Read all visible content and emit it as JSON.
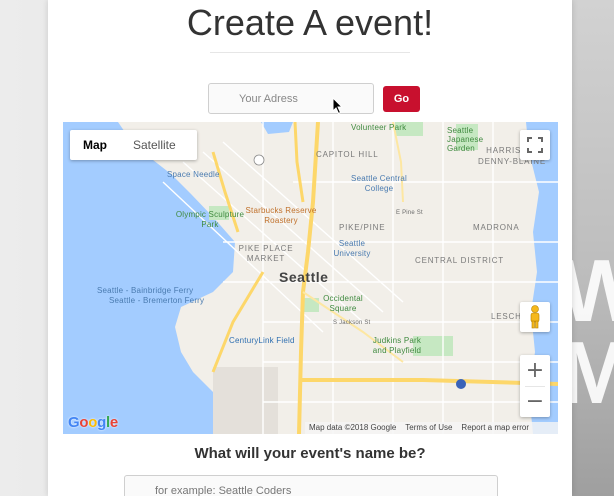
{
  "page": {
    "title": "Create A event!"
  },
  "address_form": {
    "placeholder": "Your Adress",
    "go_label": "Go",
    "accent_color": "#c8102e"
  },
  "map": {
    "type_options": [
      "Map",
      "Satellite"
    ],
    "active_type": "Map",
    "places": {
      "volunteer_park": "Volunteer Park",
      "japanese_garden": "Seattle Japanese Garden",
      "capitol_hill": "CAPITOL HILL",
      "harrison_denny_blaine": "HARRISON/ DENNY-BLAINE",
      "space_needle": "Space Needle",
      "seattle_central_college": "Seattle Central College",
      "olympic_sculpture_park": "Olympic Sculpture Park",
      "starbucks": "Starbucks Reserve Roastery",
      "pike_pine": "PIKE/PINE",
      "madrona": "MADRONA",
      "pike_place_market": "PIKE PLACE MARKET",
      "seattle_university": "Seattle University",
      "central_district": "CENTRAL DISTRICT",
      "city": "Seattle",
      "ferry_bainbridge": "Seattle - Bainbridge Ferry",
      "ferry_bremerton": "Seattle - Bremerton Ferry",
      "occidental_square": "Occidental Square",
      "leschi": "LESCHI",
      "centurylink_field": "CenturyLink Field",
      "judkins_park": "Judkins Park and Playfield",
      "e_pine_st": "E Pine St",
      "s_jackson_st": "S Jackson St"
    },
    "attribution": {
      "data": "Map data ©2018 Google",
      "terms": "Terms of Use",
      "report": "Report a map error"
    },
    "logo_text": "Google",
    "controls": {
      "zoom_in": "+",
      "zoom_out": "−"
    }
  },
  "event_form": {
    "question": "What will your event's name be?",
    "name_placeholder": "for example: Seattle Coders"
  }
}
